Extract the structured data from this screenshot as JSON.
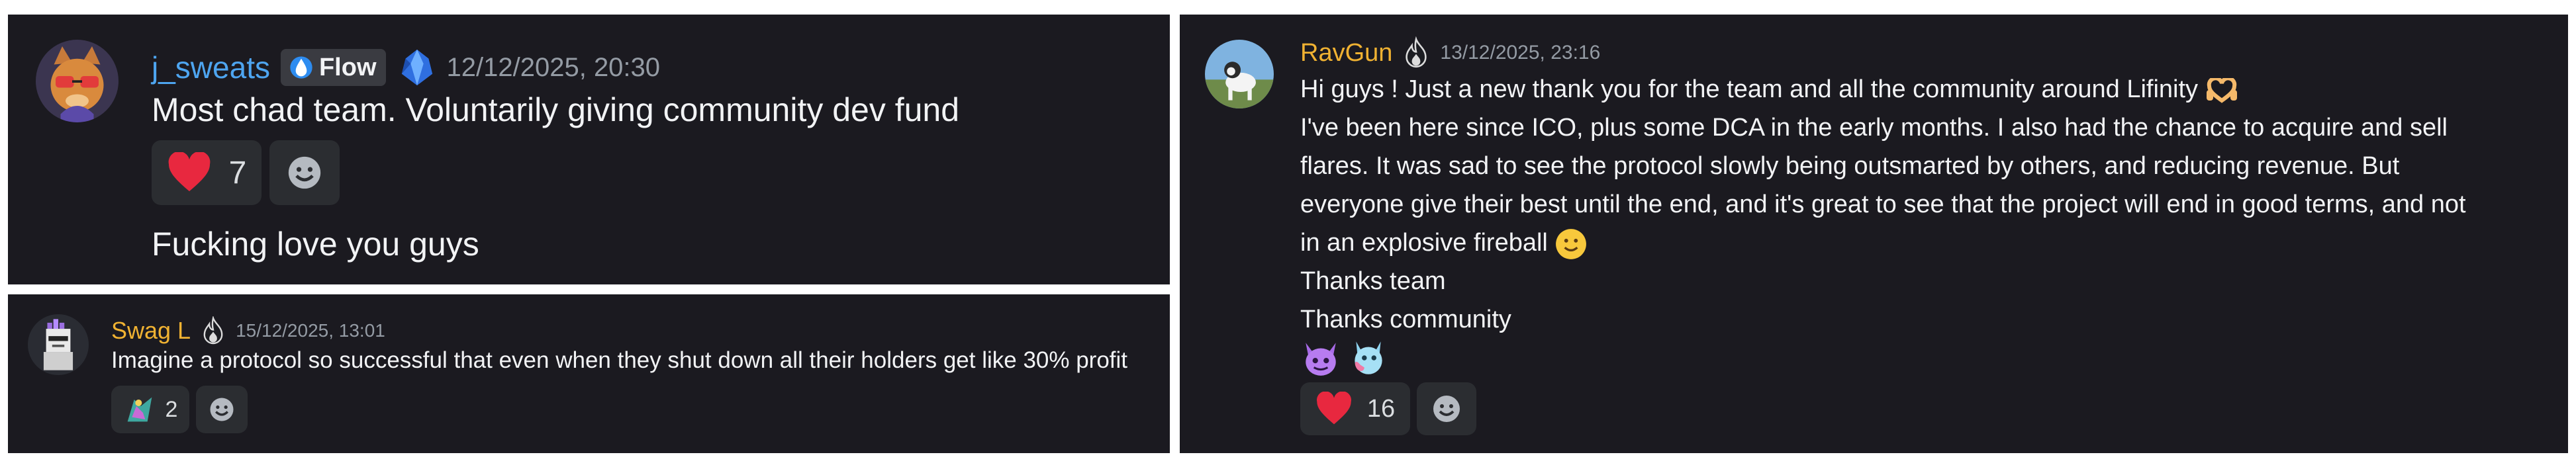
{
  "messages": [
    {
      "username": "j_sweats",
      "tag": "Flow",
      "tag_icon": "water-drop-icon",
      "badge_icon": "crystal-badge-icon",
      "timestamp": "12/12/2025, 20:30",
      "lines": [
        "Most chad team. Voluntarily giving community dev fund",
        "Fucking love you guys"
      ],
      "reactions": [
        {
          "icon": "heart-icon",
          "count": "7"
        }
      ],
      "add_reaction_icon": "add-reaction-icon",
      "username_color": "#4ea5f0"
    },
    {
      "username": "Swag L",
      "badge_icon": "flame-badge-icon",
      "timestamp": "15/12/2025, 13:01",
      "lines": [
        "Imagine a protocol so successful that even when they shut down all their holders get like 30% profit"
      ],
      "reactions": [
        {
          "icon": "custom-emoji-icon",
          "count": "2"
        }
      ],
      "add_reaction_icon": "add-reaction-icon",
      "username_color": "#f0b232"
    },
    {
      "username": "RavGun",
      "badge_icon": "flame-badge-icon",
      "timestamp": "13/12/2025, 23:16",
      "lines": [
        "Hi guys ! Just a new thank you for the team and all the community around Lifinity",
        "I've been here since ICO, plus some DCA in the early months. I also had the chance to acquire and sell",
        "flares. It was sad to see the protocol slowly being outsmarted by others, and reducing revenue. But",
        "everyone give their best until the end, and it's great to see that the project will end in good terms, and not",
        "in an explosive fireball",
        "Thanks team",
        "Thanks community"
      ],
      "inline_emojis": [
        "heart-hands-icon",
        "slight-smile-icon"
      ],
      "sticker_emojis": [
        "purple-creature-icon",
        "blue-creature-icon"
      ],
      "reactions": [
        {
          "icon": "heart-icon",
          "count": "16"
        }
      ],
      "add_reaction_icon": "add-reaction-icon",
      "username_color": "#f0b232"
    }
  ]
}
